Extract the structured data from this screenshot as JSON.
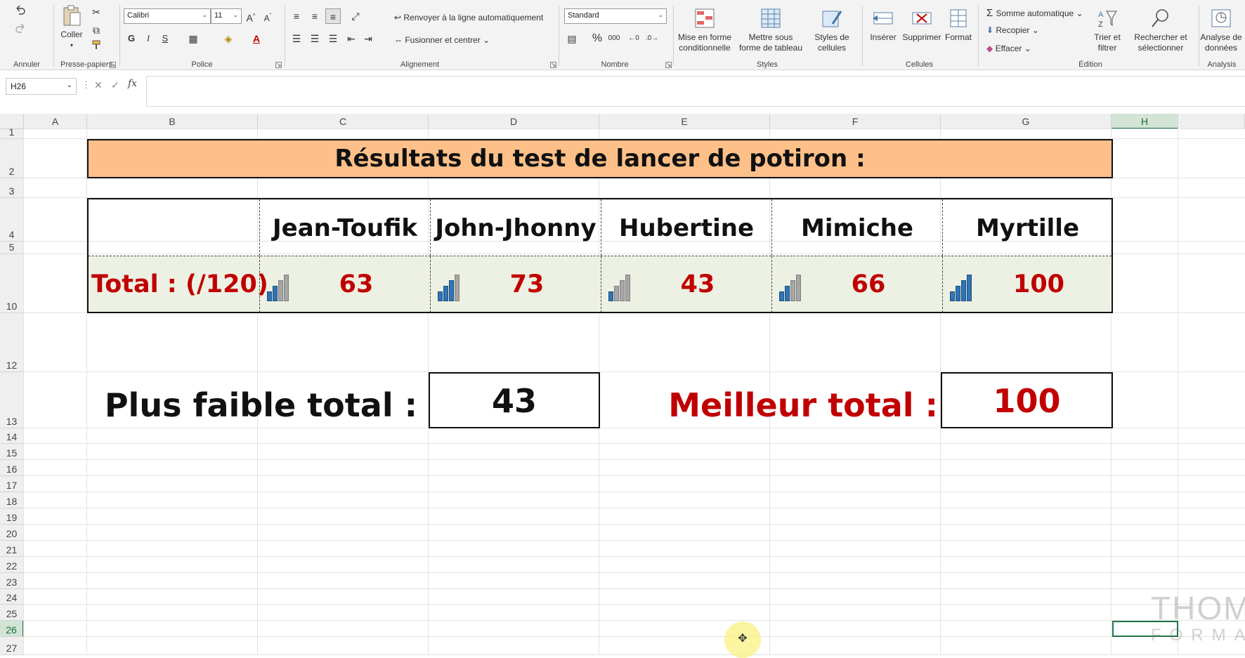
{
  "ribbon": {
    "undo_group": {
      "label": "Annuler"
    },
    "clipboard": {
      "label": "Presse-papiers",
      "paste": "Coller"
    },
    "font": {
      "label": "Police",
      "name": "Calibri",
      "size": "11",
      "bold": "G",
      "italic": "I",
      "underline": "S"
    },
    "alignment": {
      "label": "Alignement",
      "wrap": "Renvoyer à la ligne automatiquement",
      "merge": "Fusionner et centrer"
    },
    "number": {
      "label": "Nombre",
      "format": "Standard",
      "percent": "%",
      "thousands": "000"
    },
    "styles": {
      "label": "Styles",
      "cond_format": "Mise en forme conditionnelle",
      "format_table": "Mettre sous forme de tableau",
      "cell_styles": "Styles de cellules"
    },
    "cells": {
      "label": "Cellules",
      "insert": "Insérer",
      "delete": "Supprimer",
      "format": "Format"
    },
    "editing": {
      "label": "Édition",
      "autosum": "Somme automatique",
      "fill": "Recopier",
      "clear": "Effacer",
      "sort_filter": "Trier et filtrer",
      "find_select": "Rechercher et sélectionner"
    },
    "analysis": {
      "label": "Analysis",
      "analyze_data": "Analyse de données"
    }
  },
  "formula_bar": {
    "name_box": "H26",
    "fx": "fx",
    "formula": ""
  },
  "columns": [
    "A",
    "B",
    "C",
    "D",
    "E",
    "F",
    "G",
    "H"
  ],
  "selected_column": "H",
  "rows": [
    "1",
    "2",
    "3",
    "4",
    "5",
    "10",
    "12",
    "13",
    "14",
    "15",
    "16",
    "17",
    "18",
    "19",
    "20",
    "21",
    "22",
    "23",
    "24",
    "25",
    "26",
    "27"
  ],
  "selected_row": "26",
  "sheet": {
    "title": "Résultats du test de lancer de potiron :",
    "total_label": "Total : (/120)",
    "players": [
      {
        "name": "Jean-Toufik",
        "score": "63"
      },
      {
        "name": "John-Jhonny",
        "score": "73"
      },
      {
        "name": "Hubertine",
        "score": "43"
      },
      {
        "name": "Mimiche",
        "score": "66"
      },
      {
        "name": "Myrtille",
        "score": "100"
      }
    ],
    "low_label": "Plus faible total :",
    "low_value": "43",
    "best_label": "Meilleur total :",
    "best_value": "100"
  },
  "watermark": {
    "line1": "THOM",
    "line2": "FORMA"
  },
  "colors": {
    "title_fill": "#fdc089",
    "total_fill": "#edf1e3",
    "accent_red": "#c00000",
    "excel_green": "#217346",
    "bar_blue": "#2e75b6",
    "bar_gray": "#a6a6a6"
  },
  "icon_levels": [
    2,
    3,
    1,
    2,
    4
  ]
}
